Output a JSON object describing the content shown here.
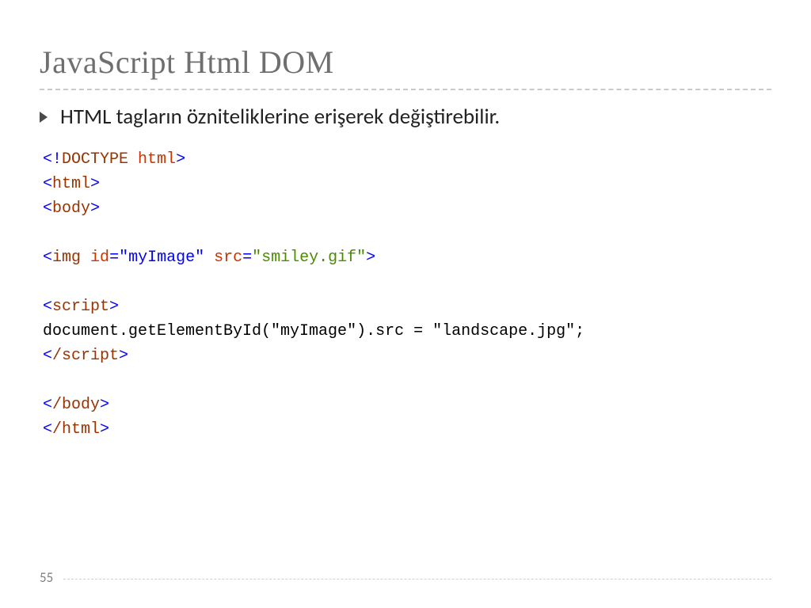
{
  "slide": {
    "title": "JavaScript Html DOM",
    "bullet": "HTML tagların özniteliklerine erişerek değiştirebilir.",
    "page_number": "55"
  },
  "code": {
    "tokens": [
      {
        "t": "<!",
        "c": "blue"
      },
      {
        "t": "DOCTYPE",
        "c": "brown"
      },
      {
        "t": " ",
        "c": ""
      },
      {
        "t": "html",
        "c": "red"
      },
      {
        "t": ">",
        "c": "blue"
      },
      {
        "t": "\n",
        "c": ""
      },
      {
        "t": "<",
        "c": "blue"
      },
      {
        "t": "html",
        "c": "brown"
      },
      {
        "t": ">",
        "c": "blue"
      },
      {
        "t": "\n",
        "c": ""
      },
      {
        "t": "<",
        "c": "blue"
      },
      {
        "t": "body",
        "c": "brown"
      },
      {
        "t": ">",
        "c": "blue"
      },
      {
        "t": "\n",
        "c": ""
      },
      {
        "t": "\n",
        "c": ""
      },
      {
        "t": "<",
        "c": "blue"
      },
      {
        "t": "img",
        "c": "brown"
      },
      {
        "t": " ",
        "c": ""
      },
      {
        "t": "id",
        "c": "red"
      },
      {
        "t": "=\"myImage\"",
        "c": "blue"
      },
      {
        "t": " ",
        "c": ""
      },
      {
        "t": "src",
        "c": "red"
      },
      {
        "t": "=",
        "c": "blue"
      },
      {
        "t": "\"smiley.gif\"",
        "c": "green"
      },
      {
        "t": ">",
        "c": "blue"
      },
      {
        "t": "\n",
        "c": ""
      },
      {
        "t": "\n",
        "c": ""
      },
      {
        "t": "<",
        "c": "blue"
      },
      {
        "t": "script",
        "c": "brown"
      },
      {
        "t": ">",
        "c": "blue"
      },
      {
        "t": "\n",
        "c": ""
      },
      {
        "t": "document.getElementById(\"myImage\").src = \"landscape.jpg\";",
        "c": ""
      },
      {
        "t": "\n",
        "c": ""
      },
      {
        "t": "<",
        "c": "blue"
      },
      {
        "t": "/script",
        "c": "brown"
      },
      {
        "t": ">",
        "c": "blue"
      },
      {
        "t": "\n",
        "c": ""
      },
      {
        "t": "\n",
        "c": ""
      },
      {
        "t": "<",
        "c": "blue"
      },
      {
        "t": "/body",
        "c": "brown"
      },
      {
        "t": ">",
        "c": "blue"
      },
      {
        "t": "\n",
        "c": ""
      },
      {
        "t": "<",
        "c": "blue"
      },
      {
        "t": "/html",
        "c": "brown"
      },
      {
        "t": ">",
        "c": "blue"
      }
    ]
  }
}
